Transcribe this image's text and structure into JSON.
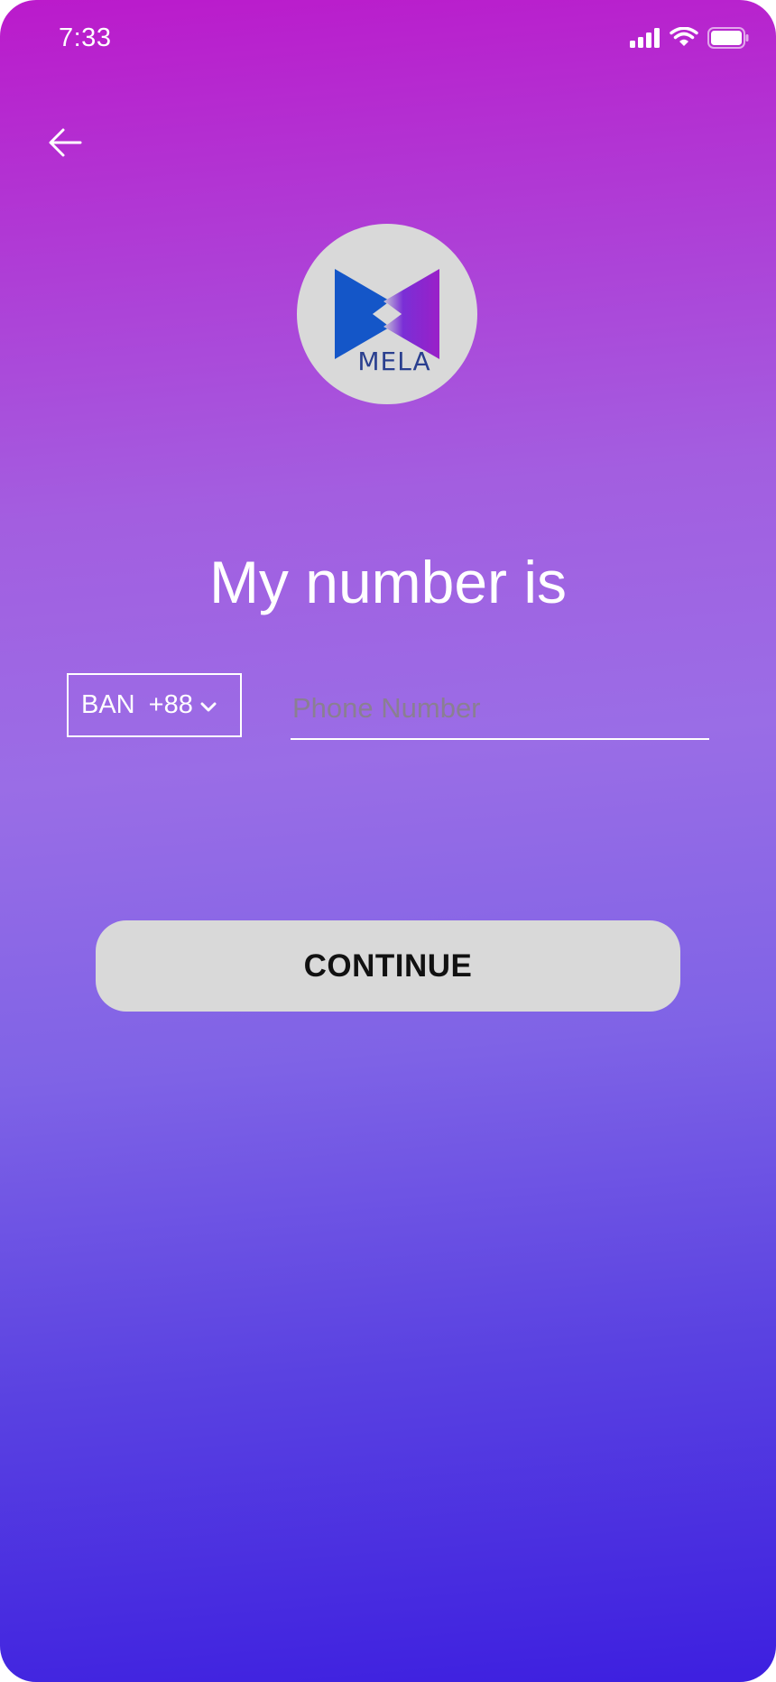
{
  "status_bar": {
    "time": "7:33",
    "icons": [
      "cellular-signal-icon",
      "wifi-icon",
      "battery-icon"
    ]
  },
  "nav": {
    "back_icon": "arrow-left-icon"
  },
  "logo": {
    "text": "MELA",
    "colors": {
      "circle": "#d9d9d9",
      "blue": "#1a56c9",
      "purple": "#8b1fd0"
    }
  },
  "heading": "My number is",
  "country": {
    "code": "BAN",
    "dial_code": "+88",
    "dropdown_icon": "chevron-down-icon"
  },
  "phone_input": {
    "value": "",
    "placeholder": "Phone Number"
  },
  "continue_label": "CONTINUE",
  "colors": {
    "gradient_top": "#bb1acb",
    "gradient_mid": "#9a6de6",
    "gradient_bottom": "#3d1fe0",
    "button_bg": "#d9d9d9"
  }
}
